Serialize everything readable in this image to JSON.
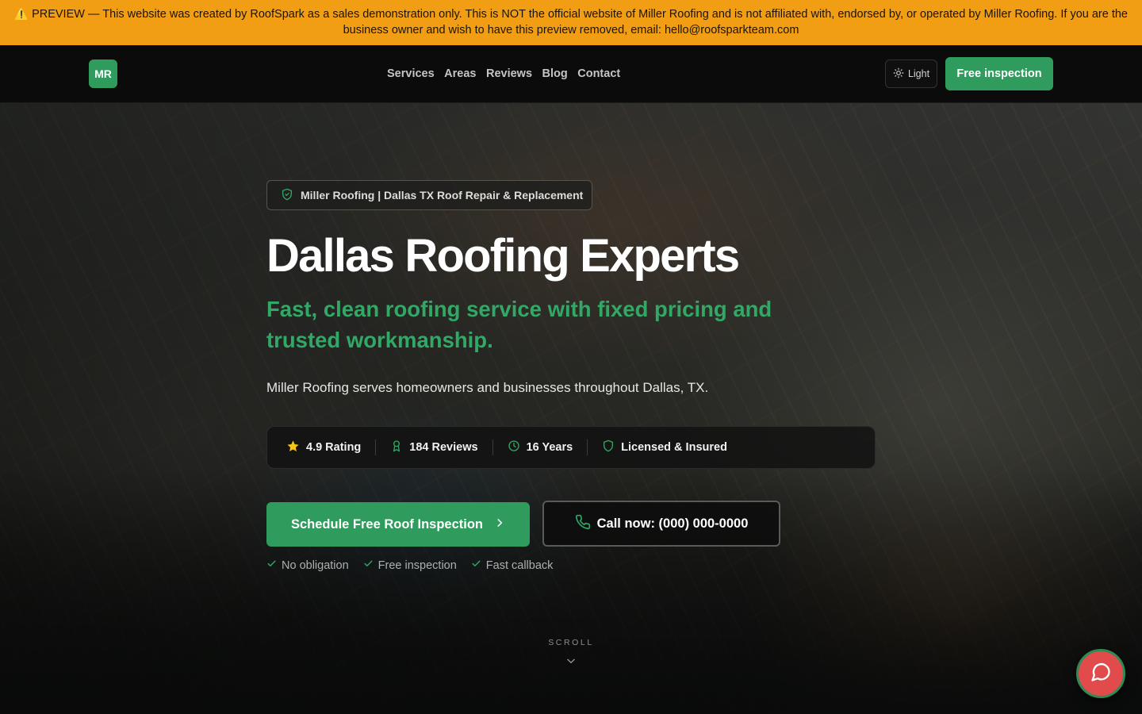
{
  "banner": {
    "icon": "warning-icon",
    "text": "⚠️ PREVIEW — This website was created by RoofSpark as a sales demonstration only. This is NOT the official website of Miller Roofing and is not affiliated with, endorsed by, or operated by Miller Roofing. If you are the business owner and wish to have this preview removed, email: hello@roofsparkteam.com"
  },
  "header": {
    "logo": "MR",
    "nav": [
      "Services",
      "Areas",
      "Reviews",
      "Blog",
      "Contact"
    ],
    "theme_label": "Light",
    "cta_label": "Free inspection"
  },
  "hero": {
    "tagline": "Miller Roofing | Dallas TX Roof Repair & Replacement",
    "title": "Dallas Roofing Experts",
    "subtitle": "Fast, clean roofing service with fixed pricing and trusted workmanship.",
    "description": "Miller Roofing serves homeowners and businesses throughout Dallas, TX.",
    "stats": [
      {
        "icon": "star-icon",
        "label": "4.9 Rating"
      },
      {
        "icon": "award-icon",
        "label": "184 Reviews"
      },
      {
        "icon": "clock-icon",
        "label": "16 Years"
      },
      {
        "icon": "shield-icon",
        "label": "Licensed & Insured"
      }
    ],
    "primary_cta": "Schedule Free Roof Inspection",
    "call_cta": "Call now: (000) 000-0000",
    "perks": [
      "No obligation",
      "Free inspection",
      "Fast callback"
    ],
    "scroll_label": "SCROLL"
  },
  "colors": {
    "brand_green": "#2f9c5e",
    "banner_orange": "#f29e14",
    "chat_red": "#e14b4b"
  }
}
